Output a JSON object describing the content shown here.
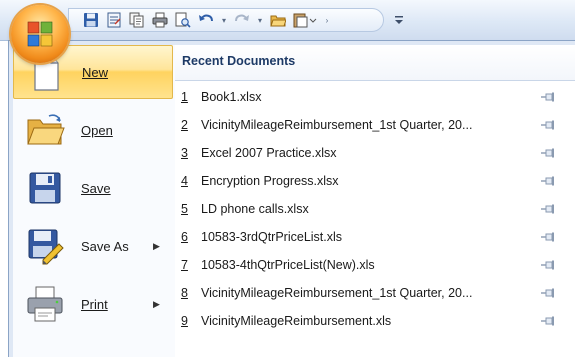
{
  "qat": {
    "buttons": [
      {
        "name": "save-icon"
      },
      {
        "name": "form-icon"
      },
      {
        "name": "copy-icon"
      },
      {
        "name": "print-icon"
      },
      {
        "name": "print-preview-icon"
      },
      {
        "name": "undo-icon"
      },
      {
        "name": "redo-icon"
      },
      {
        "name": "open-folder-icon"
      },
      {
        "name": "paste-options-icon"
      }
    ],
    "customize_icon": "customize-toolbar-icon"
  },
  "menu": {
    "commands": [
      {
        "id": "new",
        "label": "New",
        "icon": "new-document-icon",
        "has_submenu": false
      },
      {
        "id": "open",
        "label": "Open",
        "icon": "open-folder-icon",
        "has_submenu": false
      },
      {
        "id": "save",
        "label": "Save",
        "icon": "save-disk-icon",
        "has_submenu": false
      },
      {
        "id": "save-as",
        "label": "Save As",
        "icon": "save-as-icon",
        "has_submenu": true
      },
      {
        "id": "print",
        "label": "Print",
        "icon": "printer-icon",
        "has_submenu": true
      }
    ],
    "recent": {
      "title": "Recent Documents",
      "documents": [
        {
          "num": "1",
          "name": "Book1.xlsx"
        },
        {
          "num": "2",
          "name": "VicinityMileageReimbursement_1st Quarter, 20..."
        },
        {
          "num": "3",
          "name": "Excel 2007 Practice.xlsx"
        },
        {
          "num": "4",
          "name": "Encryption Progress.xlsx"
        },
        {
          "num": "5",
          "name": "LD phone calls.xlsx"
        },
        {
          "num": "6",
          "name": "10583-3rdQtrPriceList.xls"
        },
        {
          "num": "7",
          "name": "10583-4thQtrPriceList(New).xls"
        },
        {
          "num": "8",
          "name": "VicinityMileageReimbursement_1st Quarter, 20..."
        },
        {
          "num": "9",
          "name": "VicinityMileageReimbursement.xls"
        }
      ]
    }
  },
  "colors": {
    "highlight": "#ffd35f",
    "menu_border": "#8ba4c6",
    "title_text": "#1d3a66"
  }
}
